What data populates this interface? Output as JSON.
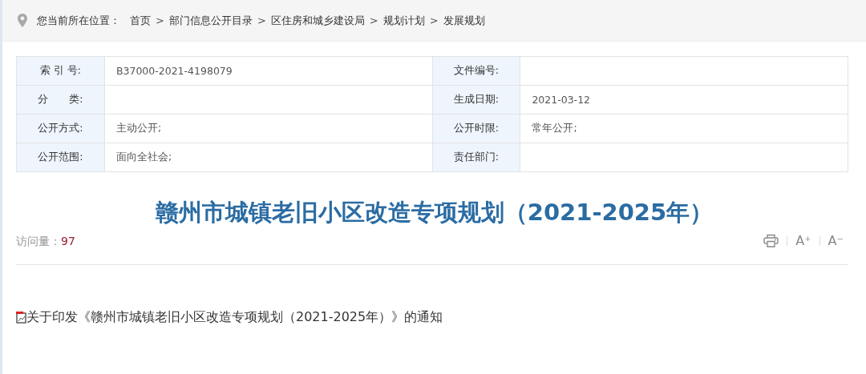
{
  "breadcrumb": {
    "label": "您当前所在位置：",
    "items": [
      "首页",
      "部门信息公开目录",
      "区住房和城乡建设局",
      "规划计划",
      "发展规划"
    ],
    "separator": ">"
  },
  "meta_table": {
    "rows": [
      [
        {
          "label": "索 引 号:",
          "value": "B37000-2021-4198079"
        },
        {
          "label": "文件编号:"
        }
      ],
      [
        {
          "label": "分　　类:"
        },
        {
          "label": "生成日期:",
          "value": "2021-03-12"
        }
      ],
      [
        {
          "label": "公开方式:",
          "value": "主动公开;"
        },
        {
          "label": "公开时限:",
          "value": "常年公开;"
        }
      ],
      [
        {
          "label": "公开范围:",
          "value": "面向全社会;"
        },
        {
          "label": "责任部门:"
        }
      ]
    ]
  },
  "title": "赣州市城镇老旧小区改造专项规划（2021-2025年）",
  "visits": {
    "label": "访问量：",
    "count": "97"
  },
  "font_tools": [
    "A⁺",
    "A⁻"
  ],
  "attachment": "关于印发《赣州市城镇老旧小区改造专项规划（2021-2025年）》的通知"
}
